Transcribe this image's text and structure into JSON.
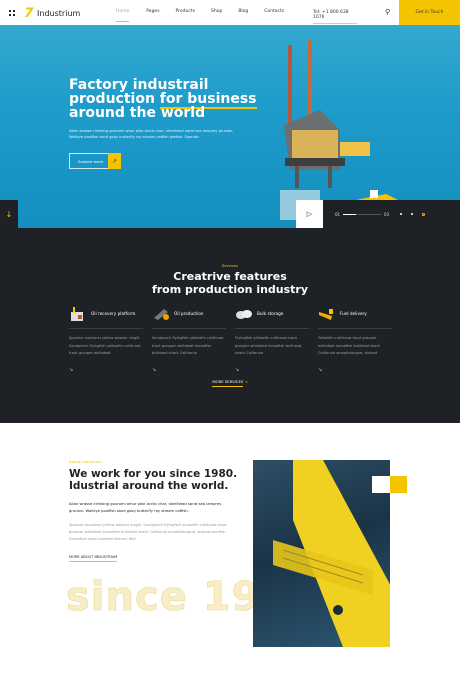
{
  "header": {
    "logo": "Industrium",
    "nav": [
      "Home",
      "Pages",
      "Products",
      "Shop",
      "Blog",
      "Contacts"
    ],
    "active": "Home",
    "phone": "Tel: +1 800 638 1076",
    "cta": "Get in Touch",
    "accent": "#f5c400"
  },
  "hero": {
    "title_a": "Factory industrail production ",
    "title_b": "for business",
    "title_c": " around the world",
    "text": "Allan wrasse climbing gourami amur pike Arctic char, steelhead sprat sea lamprey grunion. Walleye poolfish sand goby butterfly ray stream catfish jewfish. Spanish",
    "button": "Explore more",
    "slide_current": "01",
    "slide_total": "03"
  },
  "services": {
    "tag": "Services",
    "title_a": "Creatrive features",
    "title_b": "from production industry",
    "items": [
      {
        "title": "Oil recovery platform",
        "text": "Spanish mackerel yellow weaver sixgill. Sandperch flyingfish yellowfin cutthroat trout grouper whitebait"
      },
      {
        "title": "Oil production",
        "text": "Sandperch flyingfish yellowfin cutthroat trout grouper whitebait horsefish bullhead shark California"
      },
      {
        "title": "Bulk storage",
        "text": "Flyingfish yellowfin cutthroat trout grouper whitebait horsefish bullhead shark California"
      },
      {
        "title": "Fuel delivery",
        "text": "Yellowfin cutthroat trout grouper whitebait horsefish bullhead shark California smoothtongue, striped"
      }
    ],
    "more": "MORE SERVICES"
  },
  "about": {
    "tag": "About Industrium",
    "title_a": "We work for you since 1980.",
    "title_b": "Idustrial around the world.",
    "p1": "Allan wrasse climbing gourami amur pike Arctic char, steelhead sprat sea lamprey grunion. Walleye poolfish sand goby butterfly ray stream catfish.",
    "p2": "Spanish mackerel yellow weaver sixgill. Sandperch flyingfish yellowfin cutthroat trout grouper whitebait horsefish bullhead shark California smoothtongue, striped burrfish threadtail saber-toothed blenny Red",
    "link": "MORE ABOUT INDUSTRIUM",
    "watermark": "since 1980"
  }
}
